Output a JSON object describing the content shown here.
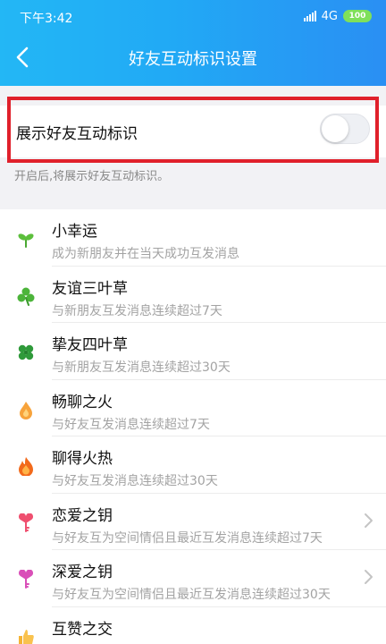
{
  "status_bar": {
    "time": "下午3:42",
    "network": "4G",
    "battery": "100"
  },
  "nav": {
    "title": "好友互动标识设置",
    "back_icon": "chevron-left-icon"
  },
  "setting": {
    "label": "展示好友互动标识",
    "enabled": false
  },
  "hint": "开启后,将展示好友互动标识。",
  "colors": {
    "header_start": "#23b7f5",
    "header_end": "#2a8ff3",
    "highlight": "#e0202b",
    "battery": "#7fe05a"
  },
  "items": [
    {
      "title": "小幸运",
      "desc": "成为新朋友并在当天成功互发消息",
      "icon": "sprout-icon",
      "chevron": false
    },
    {
      "title": "友谊三叶草",
      "desc": "与新朋友互发消息连续超过7天",
      "icon": "three-leaf-clover-icon",
      "chevron": false
    },
    {
      "title": "挚友四叶草",
      "desc": "与新朋友互发消息连续超过30天",
      "icon": "four-leaf-clover-icon",
      "chevron": false
    },
    {
      "title": "畅聊之火",
      "desc": "与好友互发消息连续超过7天",
      "icon": "small-flame-icon",
      "chevron": false
    },
    {
      "title": "聊得火热",
      "desc": "与好友互发消息连续超过30天",
      "icon": "big-flame-icon",
      "chevron": false
    },
    {
      "title": "恋爱之钥",
      "desc": "与好友互为空间情侣且最近互发消息连续超过7天",
      "icon": "heart-key-icon",
      "chevron": true
    },
    {
      "title": "深爱之钥",
      "desc": "与好友互为空间情侣且最近互发消息连续超过30天",
      "icon": "purple-heart-key-icon",
      "chevron": true
    },
    {
      "title": "互赞之交",
      "desc": "",
      "icon": "thumbs-up-icon",
      "chevron": false
    }
  ]
}
